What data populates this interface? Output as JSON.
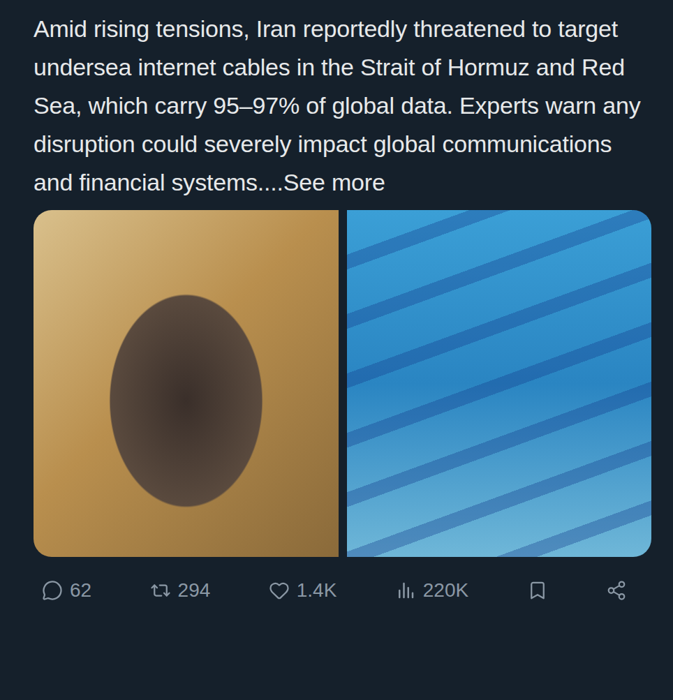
{
  "post": {
    "text": "Amid rising tensions, Iran reportedly threatened to target undersea internet cables in the Strait of Hormuz and Red Sea, which carry 95–97% of global data. Experts warn any disruption could severely impact global communications and financial systems....",
    "see_more": "See more"
  },
  "media": [
    {
      "kind": "portrait"
    },
    {
      "kind": "underwater"
    }
  ],
  "actions": [
    {
      "kind": "reply",
      "count": "62"
    },
    {
      "kind": "repost",
      "count": "294"
    },
    {
      "kind": "like",
      "count": "1.4K"
    },
    {
      "kind": "views",
      "count": "220K"
    },
    {
      "kind": "bookmark",
      "count": ""
    },
    {
      "kind": "share",
      "count": ""
    }
  ]
}
